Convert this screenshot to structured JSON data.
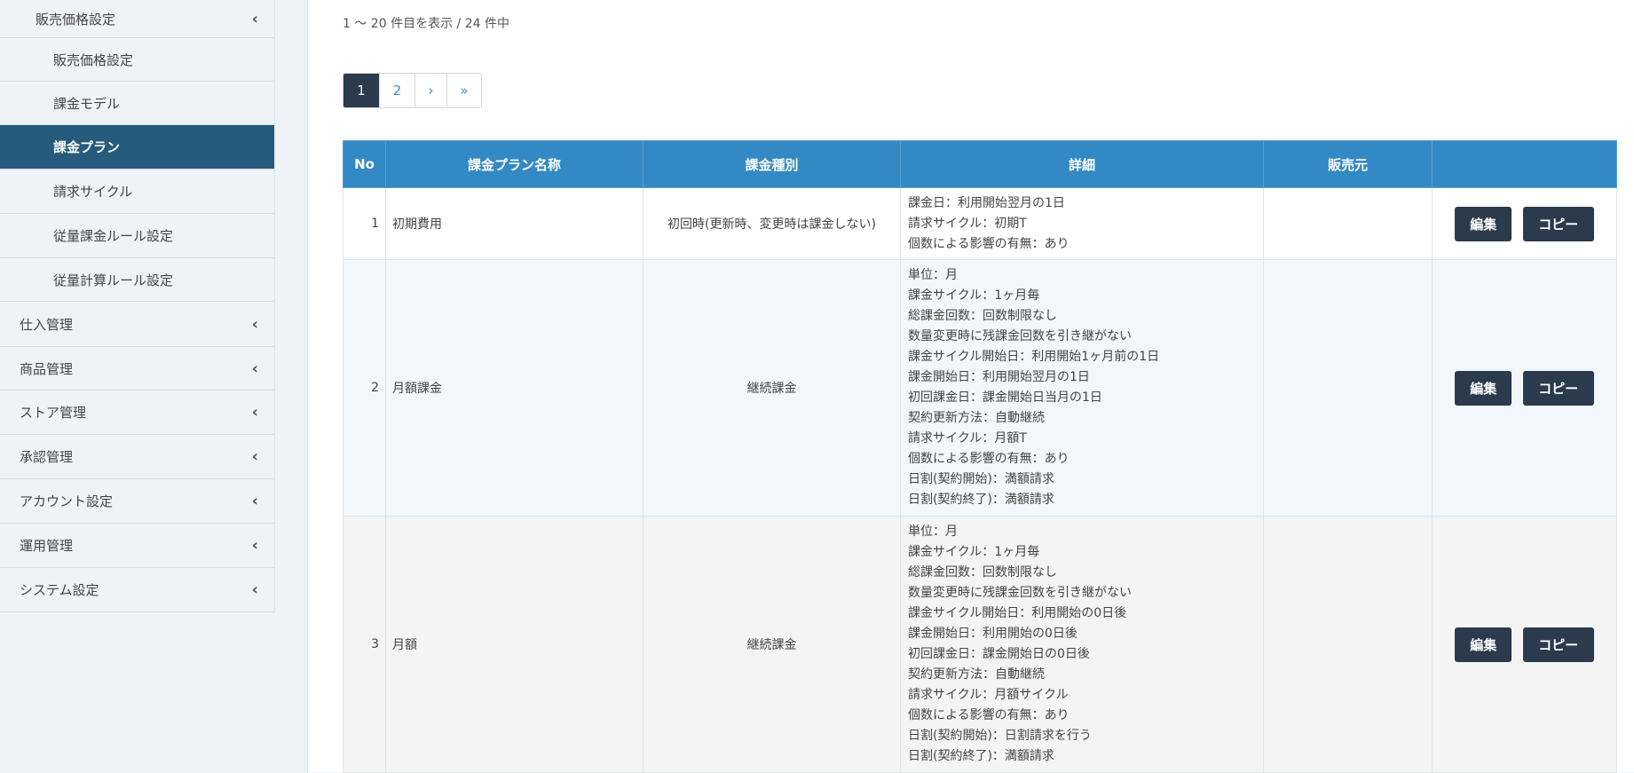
{
  "sidebar": {
    "open_parent": "販売価格設定",
    "sub_items": [
      "販売価格設定",
      "課金モデル",
      "課金プラン",
      "請求サイクル",
      "従量課金ルール設定",
      "従量計算ルール設定"
    ],
    "active_item": "課金プラン",
    "items": [
      "仕入管理",
      "商品管理",
      "ストア管理",
      "承認管理",
      "アカウント設定",
      "運用管理",
      "システム設定"
    ]
  },
  "main": {
    "count_text": "1 〜 20 件目を表示 / 24 件中",
    "pagination": [
      "1",
      "2",
      "›",
      "»"
    ],
    "table": {
      "headers": [
        "No",
        "課金プラン名称",
        "課金種別",
        "詳細",
        "販売元",
        ""
      ],
      "rows": [
        {
          "no": "1",
          "name": "初期費用",
          "kind": "初回時(更新時、変更時は課金しない)",
          "details": [
            "課金日：利用開始翌月の1日",
            "請求サイクル：初期T",
            "個数による影響の有無：あり"
          ],
          "seller": "",
          "edit": "編集",
          "copy": "コピー"
        },
        {
          "no": "2",
          "name": "月額課金",
          "kind": "継続課金",
          "details": [
            "単位：月",
            "課金サイクル：1ヶ月毎",
            "総課金回数：回数制限なし",
            "数量変更時に残課金回数を引き継がない",
            "課金サイクル開始日：利用開始1ヶ月前の1日",
            "課金開始日：利用開始翌月の1日",
            "初回課金日：課金開始日当月の1日",
            "契約更新方法：自動継続",
            "請求サイクル：月額T",
            "個数による影響の有無：あり",
            "日割(契約開始)：満額請求",
            "日割(契約終了)：満額請求"
          ],
          "seller": "",
          "edit": "編集",
          "copy": "コピー"
        },
        {
          "no": "3",
          "name": "月額",
          "kind": "継続課金",
          "details": [
            "単位：月",
            "課金サイクル：1ヶ月毎",
            "総課金回数：回数制限なし",
            "数量変更時に残課金回数を引き継がない",
            "課金サイクル開始日：利用開始の0日後",
            "課金開始日：利用開始の0日後",
            "初回課金日：課金開始日の0日後",
            "契約更新方法：自動継続",
            "請求サイクル：月額サイクル",
            "個数による影響の有無：あり",
            "日割(契約開始)：日割請求を行う",
            "日割(契約終了)：満額請求"
          ],
          "seller": "",
          "edit": "編集",
          "copy": "コピー"
        }
      ]
    }
  }
}
